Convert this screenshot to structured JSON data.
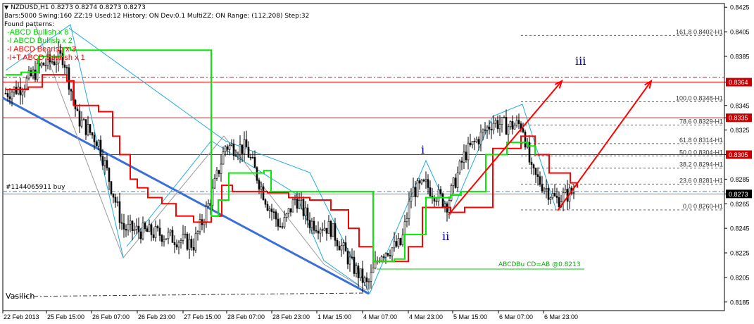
{
  "header": {
    "symbol_line": "NZDUSD,H1  0.8273 0.8274 0.8273 0.8273",
    "settings_line": "Bars:5000  Swing:160  ZZ:19  Used:12  History: ON Dev:0.1  MultiZZ: ON  Range: (112,208)  Step:32",
    "found_label": "Found patterns:",
    "patterns": [
      {
        "text": "-ABCD Bullish x 8",
        "color": "#00cc00"
      },
      {
        "text": "-I ABCD Bullish x 2",
        "color": "#00cc00"
      },
      {
        "text": "-I ABCD Bearish x 3",
        "color": "#ff0000"
      },
      {
        "text": "-I+T ABCD Bearish x 1",
        "color": "#ff0000"
      }
    ]
  },
  "labels": {
    "order": "#1144065911 buy",
    "author": "Vasilich",
    "abcd": "ABCDBu CD=AB   @0.8213",
    "wave_i": "i",
    "wave_ii": "ii",
    "wave_iii": "iii"
  },
  "colors": {
    "candles": "#000000",
    "red_line": "#ff0000",
    "green_line": "#00ee00",
    "trend": "#3a6fd8",
    "zigzag": "#22aadd",
    "wave_label": "#00008b",
    "level_tag": "#cc0000"
  },
  "chart_data": {
    "type": "candlestick",
    "symbol": "NZDUSD",
    "timeframe": "H1",
    "ylim": [
      0.8178,
      0.8428
    ],
    "y_ticks": [
      "0.8425",
      "0.8405",
      "0.8385",
      "0.8364",
      "0.8345",
      "0.8335",
      "0.8325",
      "0.8305",
      "0.8285",
      "0.8273",
      "0.8265",
      "0.8245",
      "0.8225",
      "0.8205",
      "0.8185"
    ],
    "x_ticks": [
      "22 Feb 2013",
      "25 Feb 15:00",
      "26 Feb 07:00",
      "26 Feb 23:00",
      "27 Feb 15:00",
      "28 Feb 07:00",
      "28 Feb 23:00",
      "1 Mar 15:00",
      "4 Mar 07:00",
      "4 Mar 23:00",
      "5 Mar 15:00",
      "6 Mar 07:00",
      "6 Mar 23:00"
    ],
    "current_price": 0.8273,
    "horizontal_levels": [
      {
        "price": 0.8364,
        "label": "0.8364"
      },
      {
        "price": 0.8335,
        "label": "0.8335"
      },
      {
        "price": 0.8305,
        "label": "0.8305"
      }
    ],
    "fibonacci": [
      {
        "label": "161.8 0.8402-H1",
        "price": 0.8402
      },
      {
        "label": "100.0 0.8348-H1",
        "price": 0.8348
      },
      {
        "label": "78.6 0.8329-H1",
        "price": 0.8329
      },
      {
        "label": "61.8 0.8314-H1",
        "price": 0.8314
      },
      {
        "label": "50.0 0.8304-H1",
        "price": 0.8304
      },
      {
        "label": "38.2 0.8294-H1",
        "price": 0.8294
      },
      {
        "label": "23.6 0.8281-H1",
        "price": 0.8281
      },
      {
        "label": "0.0 0.8260-H1",
        "price": 0.826
      }
    ],
    "abcd_level": 0.8213,
    "order_price": 0.8275
  }
}
